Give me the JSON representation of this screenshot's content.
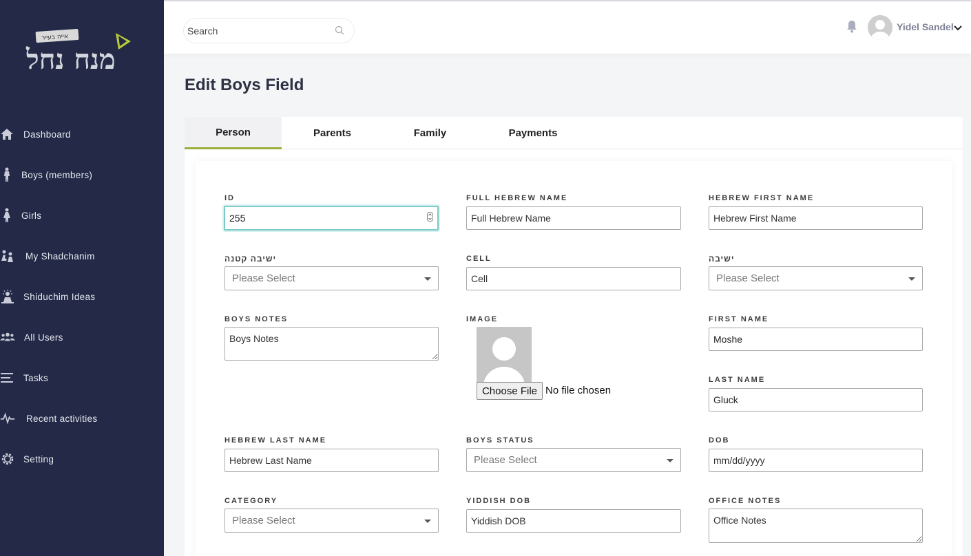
{
  "header": {
    "search_placeholder": "Search",
    "user_name": "Yidel Sandel"
  },
  "sidebar": {
    "logo_text": "מנח נחל",
    "logo_tag": "אייה בעייר",
    "items": [
      {
        "label": "Dashboard",
        "icon": "home-icon"
      },
      {
        "label": "Boys (members)",
        "icon": "boy-icon"
      },
      {
        "label": "Girls",
        "icon": "girl-icon"
      },
      {
        "label": "My Shadchanim",
        "icon": "people-icon"
      },
      {
        "label": "Shiduchim Ideas",
        "icon": "idea-icon"
      },
      {
        "label": "All Users",
        "icon": "users-icon"
      },
      {
        "label": "Tasks",
        "icon": "list-icon"
      },
      {
        "label": "Recent activities",
        "icon": "pulse-icon"
      },
      {
        "label": "Setting",
        "icon": "gear-icon"
      }
    ]
  },
  "page": {
    "title": "Edit Boys Field"
  },
  "tabs": [
    "Person",
    "Parents",
    "Family",
    "Payments"
  ],
  "form": {
    "id_label": "ID",
    "id_value": "255",
    "full_hebrew_name_label": "FULL HEBREW NAME",
    "full_hebrew_name_placeholder": "Full Hebrew Name",
    "hebrew_first_name_label": "HEBREW FIRST NAME",
    "hebrew_first_name_placeholder": "Hebrew First Name",
    "yeshiva_ketana_label": "ישיבה קטנה",
    "cell_label": "CELL",
    "cell_placeholder": "Cell",
    "yeshiva_label": "ישיבה",
    "select_placeholder": "Please Select",
    "boys_notes_label": "BOYS NOTES",
    "boys_notes_placeholder": "Boys Notes",
    "image_label": "IMAGE",
    "choose_file_label": "Choose File",
    "no_file_label": "No file chosen",
    "first_name_label": "FIRST NAME",
    "first_name_value": "Moshe",
    "last_name_label": "LAST NAME",
    "last_name_value": "Gluck",
    "hebrew_last_name_label": "HEBREW LAST NAME",
    "hebrew_last_name_placeholder": "Hebrew Last Name",
    "boys_status_label": "BOYS STATUS",
    "dob_label": "DOB",
    "dob_placeholder": "mm/dd/yyyy",
    "category_label": "CATEGORY",
    "yiddish_dob_label": "YIDDISH DOB",
    "yiddish_dob_placeholder": "Yiddish DOB",
    "office_notes_label": "OFFICE NOTES",
    "office_notes_placeholder": "Office Notes"
  },
  "colors": {
    "sidebar_bg": "#232946",
    "tab_accent": "#9aae3c",
    "focus_border": "#7cc9c9"
  }
}
